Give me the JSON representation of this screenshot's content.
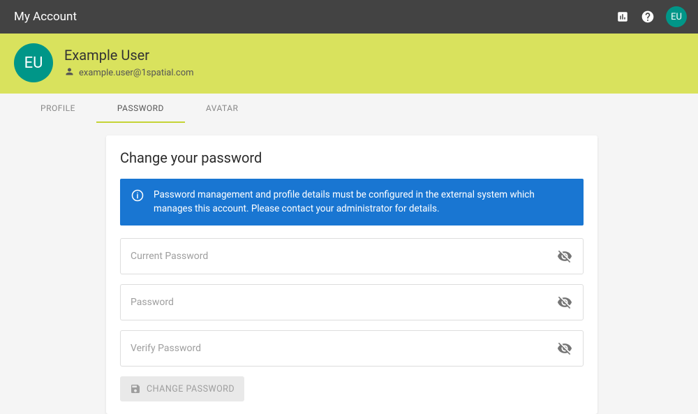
{
  "topbar": {
    "title": "My Account",
    "avatar_initials": "EU"
  },
  "header": {
    "avatar_initials": "EU",
    "name": "Example User",
    "email": "example.user@1spatial.com"
  },
  "tabs": {
    "profile": "PROFILE",
    "password": "PASSWORD",
    "avatar": "AVATAR"
  },
  "card": {
    "title": "Change your password",
    "banner_text": "Password management and profile details must be configured in the external system which manages this account. Please contact your administrator for details.",
    "current_password_placeholder": "Current Password",
    "password_placeholder": "Password",
    "verify_password_placeholder": "Verify Password",
    "change_button_label": "CHANGE PASSWORD"
  }
}
